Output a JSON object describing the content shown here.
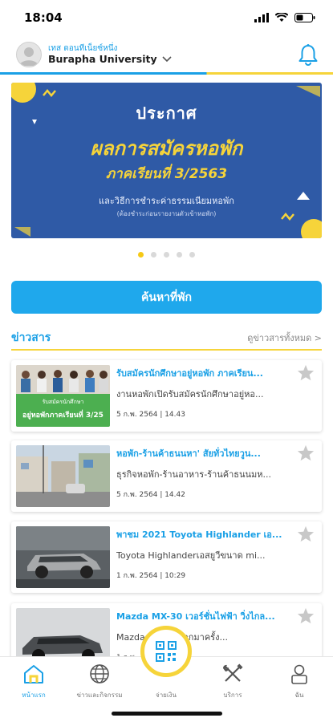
{
  "status_bar": {
    "time": "18:04"
  },
  "header": {
    "user_name": "เทส ดอนทีเน็ยซ์หนึ่ง",
    "university": "Burapha University"
  },
  "banner": {
    "line1": "ประกาศ",
    "line2": "ผลการสมัครหอพัก",
    "line3": "ภาคเรียนที่ 3/2563",
    "line4": "และวิธีการชำระค่าธรรมเนียมหอพัก",
    "line5": "(ต้องชำระก่อนรายงานตัวเข้าหอพัก)",
    "colors": {
      "background": "#2f5aa6",
      "highlight": "#f6d43a"
    }
  },
  "carousel": {
    "dot_count": 5,
    "active_index": 0
  },
  "search_button": {
    "label": "ค้นหาที่พัก"
  },
  "news": {
    "title": "ข่าวสาร",
    "view_all": "ดูข่าวสารทั้งหมด >",
    "items": [
      {
        "title": "รับสมัครนักศึกษาอยู่หอพัก ภาคเรียน...",
        "desc": "งานหอพักเปิดรับสมัครนักศึกษาอยู่หอ...",
        "date": "5 ก.พ. 2564 | 14.43",
        "thumb_caption_1": "รับสมัครนักศึกษา",
        "thumb_caption_2": "อยู่หอพักภาคเรียนที่ 3/25"
      },
      {
        "title": "หอพัก-ร้านค้าธนนหา' สัยทั่วไทยวูน...",
        "desc": "ธุรกิจหอพัก-ร้านอาหาร-ร้านค้าธนนมห...",
        "date": "5 ก.พ. 2564 | 14.42"
      },
      {
        "title": "พาชม 2021 Toyota Highlander เอ...",
        "desc": "Toyota Highlanderเอสยูวีขนาด mi...",
        "date": "1 ก.พ. 2564 | 10:29"
      },
      {
        "title": "Mazda MX-30 เวอร์ชั่นไฟฟ้า วิ่งไกล...",
        "desc": "Mazda    เผยโฉมออกมาครั้ง...",
        "date": "1 ก.พ."
      }
    ]
  },
  "tabbar": {
    "items": [
      {
        "label": "หน้าแรก",
        "icon": "home-icon",
        "active": true
      },
      {
        "label": "ข่าวและกิจกรรม",
        "icon": "globe-icon",
        "active": false
      },
      {
        "label": "จ่ายเงิน",
        "icon": "qr-code-icon",
        "active": false
      },
      {
        "label": "บริการ",
        "icon": "tools-icon",
        "active": false
      },
      {
        "label": "ฉัน",
        "icon": "person-icon",
        "active": false
      }
    ],
    "colors": {
      "active": "#1aa0e6",
      "accent": "#f6d43a"
    }
  }
}
